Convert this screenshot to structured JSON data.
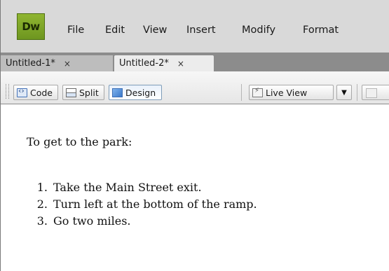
{
  "app": {
    "logo_text": "Dw",
    "menu": [
      "File",
      "Edit",
      "View",
      "Insert",
      "Modify",
      "Format"
    ]
  },
  "tabs": [
    {
      "label": "Untitled-1*",
      "close": "×",
      "active": false
    },
    {
      "label": "Untitled-2*",
      "close": "×",
      "active": true
    }
  ],
  "toolbar": {
    "code_label": "Code",
    "split_label": "Split",
    "design_label": "Design",
    "live_view_label": "Live View",
    "dropdown_glyph": "▼",
    "active_view": "Design"
  },
  "document": {
    "intro": "To get to the park:",
    "steps": [
      {
        "num": "1.",
        "text": "Take the Main Street exit."
      },
      {
        "num": "2.",
        "text": "Turn left at the bottom of the ramp."
      },
      {
        "num": "3.",
        "text": "Go two miles."
      }
    ]
  }
}
